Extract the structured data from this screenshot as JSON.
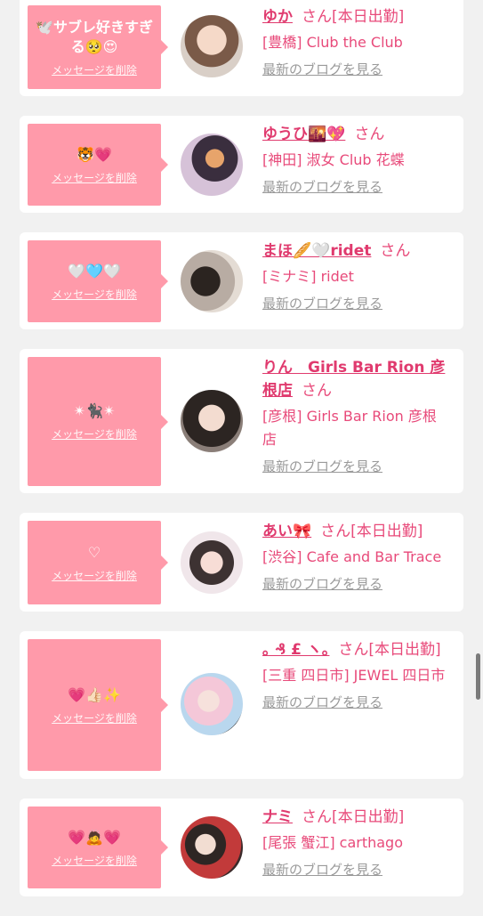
{
  "accent_color": "#ff9aaa",
  "name_color": "#e03a6e",
  "items": [
    {
      "message": "🕊️サブレ好きすぎる🥺😍",
      "delete_label": "メッセージを削除",
      "name": "ゆか",
      "san": "さん[本日出勤]",
      "shop": "[豊橋] Club the Club",
      "blog": "最新のブログを見る"
    },
    {
      "message": "🐯💗",
      "delete_label": "メッセージを削除",
      "name": "ゆうひ🌇💖",
      "san": "さん",
      "shop": "[神田] 淑女 Club 花蝶",
      "blog": "最新のブログを見る"
    },
    {
      "message": "🤍🩵🤍",
      "delete_label": "メッセージを削除",
      "name": "まほ🥖🤍ridet",
      "san": "さん",
      "shop": "[ミナミ] ridet",
      "blog": "最新のブログを見る"
    },
    {
      "message": "✴︎🐈‍⬛✴︎",
      "delete_label": "メッセージを削除",
      "name": "りん　Girls Bar Rion 彦根店",
      "san": "さん",
      "shop": "[彦根] Girls Bar Rion 彦根店",
      "blog": "最新のブログを見る"
    },
    {
      "message": "♡",
      "delete_label": "メッセージを削除",
      "name": "あい🎀",
      "san": "さん[本日出勤]",
      "shop": "[渋谷] Cafe and Bar Trace",
      "blog": "最新のブログを見る"
    },
    {
      "message": "💗👍🏻✨",
      "delete_label": "メッセージを削除",
      "name": "｡ ₰ £ ヽ｡",
      "san": "さん[本日出勤]",
      "shop": "[三重 四日市] JEWEL 四日市",
      "blog": "最新のブログを見る"
    },
    {
      "message": "💗🙇💗",
      "delete_label": "メッセージを削除",
      "name": "ナミ",
      "san": "さん[本日出勤]",
      "shop": "[尾張 蟹江] carthago",
      "blog": "最新のブログを見る"
    }
  ]
}
